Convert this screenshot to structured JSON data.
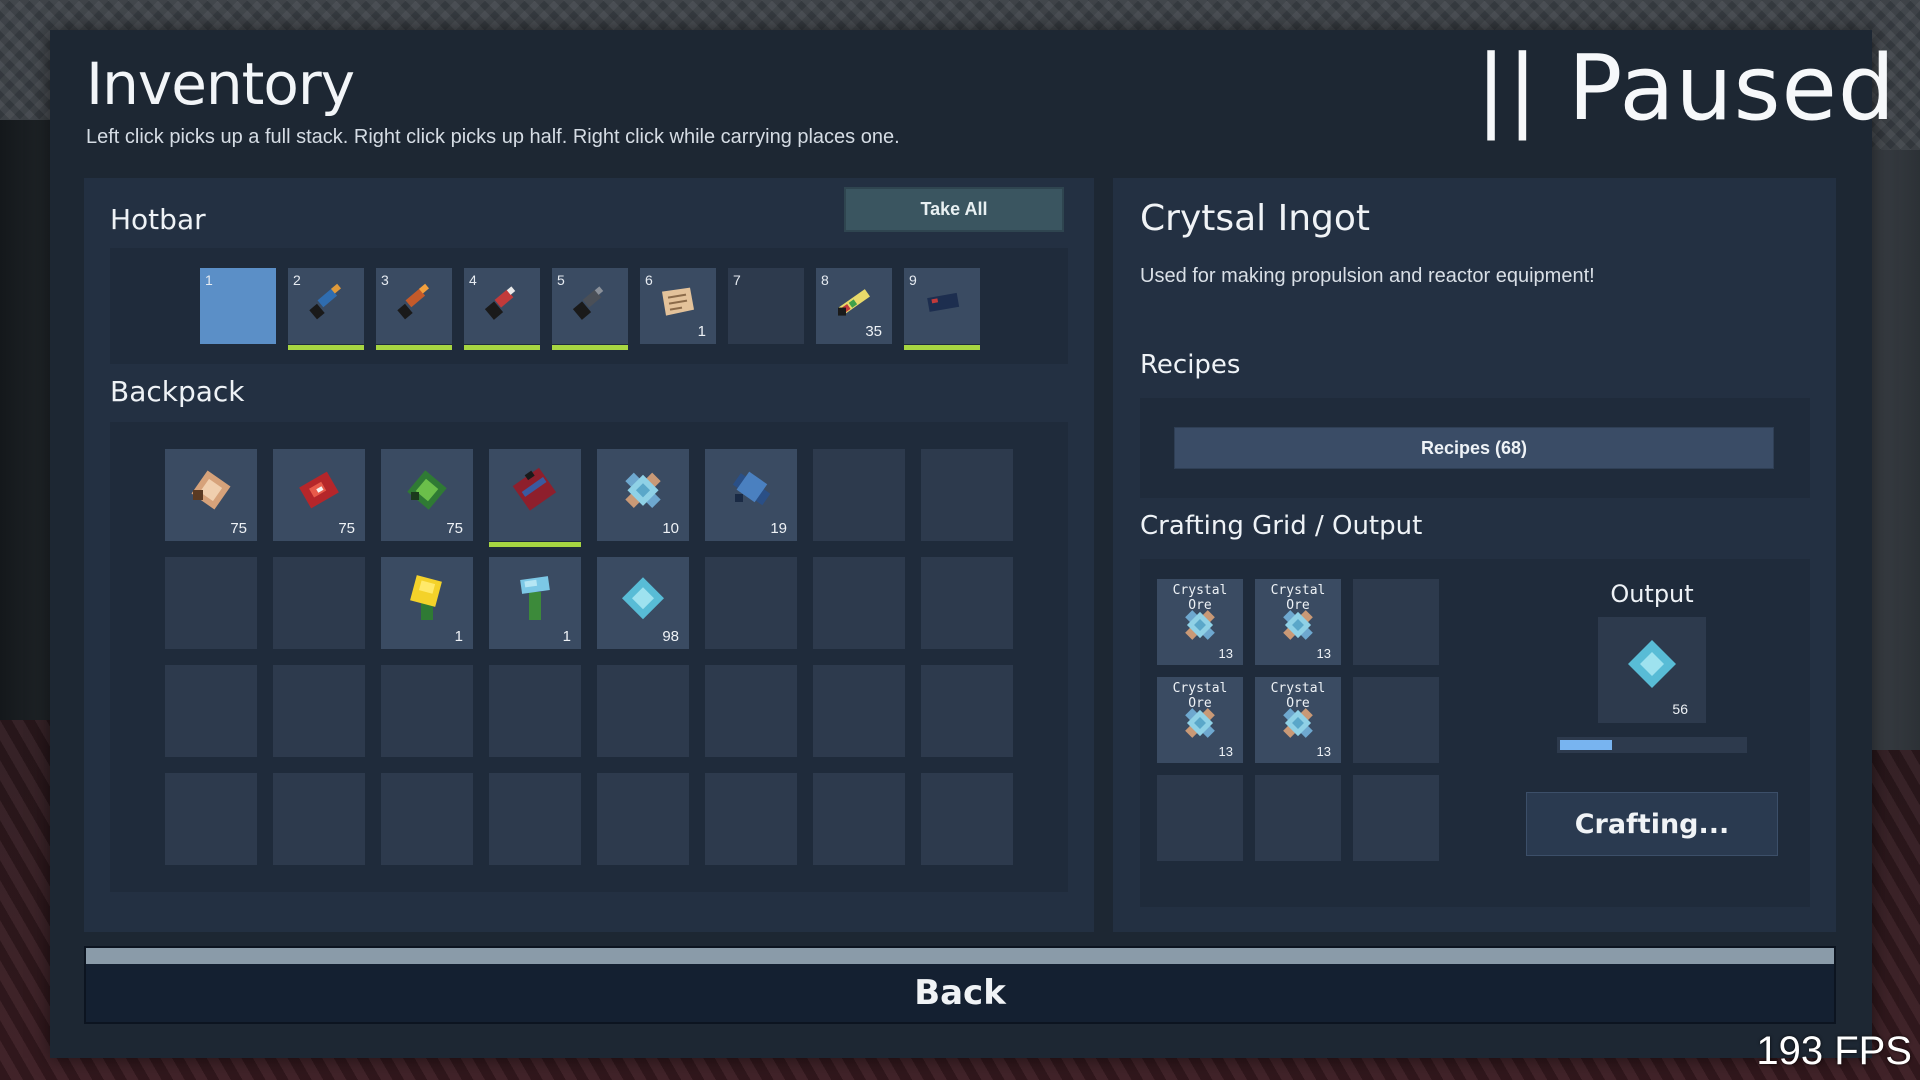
{
  "header": {
    "title": "Inventory",
    "subtitle": "Left click picks up a full stack. Right click picks up half. Right click while carrying places one.",
    "paused": "|| Paused"
  },
  "fps": "193 FPS",
  "hotbar": {
    "label": "Hotbar",
    "take_all": "Take All",
    "slots": [
      {
        "num": "1",
        "selected": true,
        "icon": "empty-icon",
        "count": "",
        "bar": false
      },
      {
        "num": "2",
        "selected": false,
        "icon": "drill-tool-blue-icon",
        "count": "",
        "bar": true
      },
      {
        "num": "3",
        "selected": false,
        "icon": "drill-tool-orange-icon",
        "count": "",
        "bar": true
      },
      {
        "num": "4",
        "selected": false,
        "icon": "drill-tool-red-icon",
        "count": "",
        "bar": true
      },
      {
        "num": "5",
        "selected": false,
        "icon": "drill-tool-grey-icon",
        "count": "",
        "bar": true
      },
      {
        "num": "6",
        "selected": false,
        "icon": "blueprint-paper-icon",
        "count": "1",
        "bar": false
      },
      {
        "num": "7",
        "selected": false,
        "icon": "empty-icon",
        "count": "",
        "bar": false
      },
      {
        "num": "8",
        "selected": false,
        "icon": "ruler-tool-icon",
        "count": "35",
        "bar": false
      },
      {
        "num": "9",
        "selected": false,
        "icon": "block-placer-icon",
        "count": "",
        "bar": true
      }
    ]
  },
  "backpack": {
    "label": "Backpack",
    "slots": [
      {
        "icon": "beige-ore-icon",
        "count": "75",
        "bar": false
      },
      {
        "icon": "red-ore-icon",
        "count": "75",
        "bar": false
      },
      {
        "icon": "green-ore-icon",
        "count": "75",
        "bar": false
      },
      {
        "icon": "red-gadget-icon",
        "count": "",
        "bar": true
      },
      {
        "icon": "crystal-ore-icon",
        "count": "10",
        "bar": false
      },
      {
        "icon": "blue-ore-icon",
        "count": "19",
        "bar": false
      },
      {
        "icon": "",
        "count": "",
        "bar": false
      },
      {
        "icon": "",
        "count": "",
        "bar": false
      },
      {
        "icon": "",
        "count": "",
        "bar": false
      },
      {
        "icon": "",
        "count": "",
        "bar": false
      },
      {
        "icon": "yellow-sapling-icon",
        "count": "1",
        "bar": false
      },
      {
        "icon": "blue-sapling-icon",
        "count": "1",
        "bar": false
      },
      {
        "icon": "crystal-ingot-icon",
        "count": "98",
        "bar": false
      },
      {
        "icon": "",
        "count": "",
        "bar": false
      },
      {
        "icon": "",
        "count": "",
        "bar": false
      },
      {
        "icon": "",
        "count": "",
        "bar": false
      },
      {
        "icon": "",
        "count": "",
        "bar": false
      },
      {
        "icon": "",
        "count": "",
        "bar": false
      },
      {
        "icon": "",
        "count": "",
        "bar": false
      },
      {
        "icon": "",
        "count": "",
        "bar": false
      },
      {
        "icon": "",
        "count": "",
        "bar": false
      },
      {
        "icon": "",
        "count": "",
        "bar": false
      },
      {
        "icon": "",
        "count": "",
        "bar": false
      },
      {
        "icon": "",
        "count": "",
        "bar": false
      },
      {
        "icon": "",
        "count": "",
        "bar": false
      },
      {
        "icon": "",
        "count": "",
        "bar": false
      },
      {
        "icon": "",
        "count": "",
        "bar": false
      },
      {
        "icon": "",
        "count": "",
        "bar": false
      },
      {
        "icon": "",
        "count": "",
        "bar": false
      },
      {
        "icon": "",
        "count": "",
        "bar": false
      },
      {
        "icon": "",
        "count": "",
        "bar": false
      },
      {
        "icon": "",
        "count": "",
        "bar": false
      }
    ]
  },
  "detail": {
    "item_name": "Crytsal Ingot",
    "description": "Used for making propulsion and reactor equipment!",
    "recipes_label": "Recipes",
    "recipes_button": "Recipes (68)",
    "crafting_label": "Crafting Grid / Output",
    "grid": [
      {
        "label": "Crystal Ore",
        "count": "13",
        "icon": "crystal-ore-icon"
      },
      {
        "label": "Crystal Ore",
        "count": "13",
        "icon": "crystal-ore-icon"
      },
      {
        "label": "",
        "count": "",
        "icon": ""
      },
      {
        "label": "Crystal Ore",
        "count": "13",
        "icon": "crystal-ore-icon"
      },
      {
        "label": "Crystal Ore",
        "count": "13",
        "icon": "crystal-ore-icon"
      },
      {
        "label": "",
        "count": "",
        "icon": ""
      },
      {
        "label": "",
        "count": "",
        "icon": ""
      },
      {
        "label": "",
        "count": "",
        "icon": ""
      },
      {
        "label": "",
        "count": "",
        "icon": ""
      }
    ],
    "output_label": "Output",
    "output_count": "56",
    "output_icon": "crystal-ingot-icon",
    "progress": 0.28,
    "crafting_button": "Crafting..."
  },
  "back_button": "Back",
  "colors": {
    "selected_slot": "#5b8fc7",
    "durability_bar": "#a7d642",
    "progress_fill": "#78b4f0",
    "take_all_bg": "#3a5560"
  }
}
